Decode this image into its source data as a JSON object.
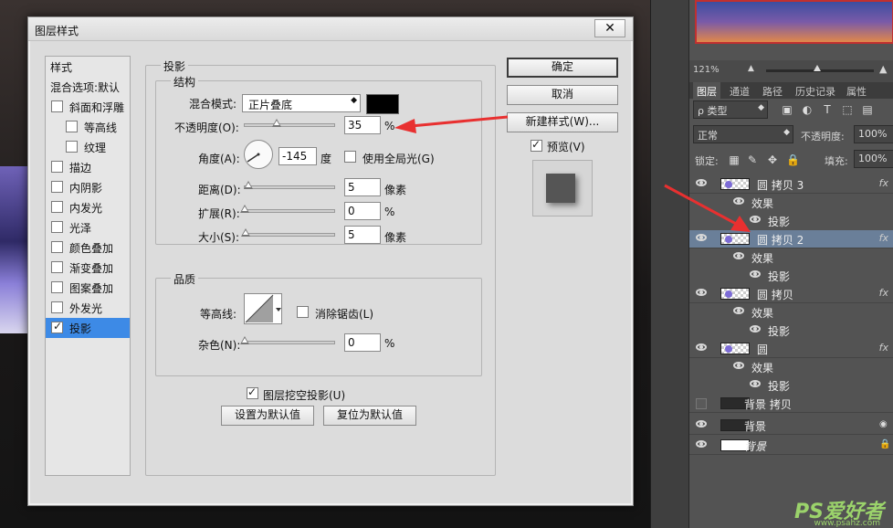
{
  "dialog": {
    "title": "图层样式",
    "close_label": "✕",
    "nav": {
      "header": "样式",
      "blend_options": "混合选项:默认",
      "items": [
        {
          "label": "斜面和浮雕",
          "checked": false
        },
        {
          "label": "等高线",
          "checked": false
        },
        {
          "label": "纹理",
          "checked": false
        },
        {
          "label": "描边",
          "checked": false
        },
        {
          "label": "内阴影",
          "checked": false
        },
        {
          "label": "内发光",
          "checked": false
        },
        {
          "label": "光泽",
          "checked": false
        },
        {
          "label": "颜色叠加",
          "checked": false
        },
        {
          "label": "渐变叠加",
          "checked": false
        },
        {
          "label": "图案叠加",
          "checked": false
        },
        {
          "label": "外发光",
          "checked": false
        },
        {
          "label": "投影",
          "checked": true
        }
      ]
    },
    "section_title": "投影",
    "structure": {
      "legend": "结构",
      "blend_mode_label": "混合模式:",
      "blend_mode_value": "正片叠底",
      "shadow_color": "#000000",
      "opacity_label": "不透明度(O):",
      "opacity_value": "35",
      "opacity_unit": "%",
      "opacity_level": 35,
      "angle_label": "角度(A):",
      "angle_value": "-145",
      "angle_unit": "度",
      "global_light_label": "使用全局光(G)",
      "global_light_checked": false,
      "distance_label": "距离(D):",
      "distance_value": "5",
      "distance_unit": "像素",
      "spread_label": "扩展(R):",
      "spread_value": "0",
      "spread_unit": "%",
      "size_label": "大小(S):",
      "size_value": "5",
      "size_unit": "像素"
    },
    "quality": {
      "legend": "品质",
      "contour_label": "等高线:",
      "antialias_label": "消除锯齿(L)",
      "antialias_checked": false,
      "noise_label": "杂色(N):",
      "noise_value": "0",
      "noise_unit": "%"
    },
    "knockout_label": "图层挖空投影(U)",
    "knockout_checked": true,
    "set_default_label": "设置为默认值",
    "reset_default_label": "复位为默认值",
    "buttons": {
      "ok": "确定",
      "cancel": "取消",
      "new_style": "新建样式(W)...",
      "preview_label": "预览(V)",
      "preview_checked": true
    }
  },
  "layers_panel": {
    "zoom": "121%",
    "tabs": [
      "图层",
      "通道",
      "路径",
      "历史记录",
      "属性"
    ],
    "filter_type": "ρ 类型",
    "blend_mode": "正常",
    "opacity_label": "不透明度:",
    "opacity_value": "100%",
    "lock_label": "锁定:",
    "fill_label": "填充:",
    "fill_value": "100%",
    "effects_label": "效果",
    "drop_shadow_label": "投影",
    "fx_label": "fx",
    "layers": [
      {
        "name": "圆 拷贝 3"
      },
      {
        "name": "圆 拷贝 2"
      },
      {
        "name": "圆 拷贝"
      },
      {
        "name": "圆"
      },
      {
        "name": "背景 拷贝"
      },
      {
        "name": "背景"
      },
      {
        "name": "背景"
      }
    ]
  },
  "watermark": {
    "brand": "PS爱好者",
    "url": "www.psahz.com"
  },
  "colors": {
    "annotation_red": "#e83030",
    "selected_layer": "#6a7f99",
    "active_nav": "#3d8ae6"
  }
}
